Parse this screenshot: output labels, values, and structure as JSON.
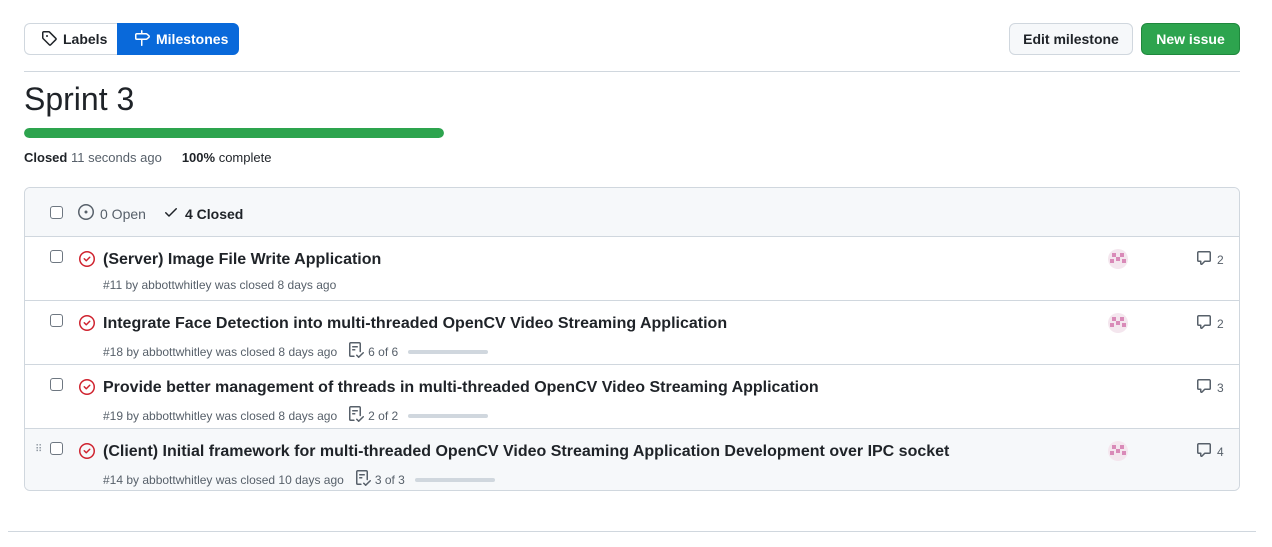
{
  "nav": {
    "labels_label": "Labels",
    "milestones_label": "Milestones"
  },
  "actions": {
    "edit_label": "Edit milestone",
    "new_issue_label": "New issue"
  },
  "milestone": {
    "title": "Sprint 3",
    "progress_percent": 100,
    "status_label": "Closed",
    "status_time": "11 seconds ago",
    "percent_text": "100%",
    "complete_text": "complete"
  },
  "filters": {
    "open_label": "0 Open",
    "closed_label": "4 Closed"
  },
  "issues": [
    {
      "title": "(Server) Image File Write Application",
      "meta": "#11 by abbottwhitley was closed 8 days ago",
      "tasks": "",
      "comments": "2",
      "has_avatar": true
    },
    {
      "title": "Integrate Face Detection into multi-threaded OpenCV Video Streaming Application",
      "meta": "#18 by abbottwhitley was closed 8 days ago",
      "tasks": "6 of 6",
      "comments": "2",
      "has_avatar": true
    },
    {
      "title": "Provide better management of threads in multi-threaded OpenCV Video Streaming Application",
      "meta": "#19 by abbottwhitley was closed 8 days ago",
      "tasks": "2 of 2",
      "comments": "3",
      "has_avatar": false
    },
    {
      "title": "(Client) Initial framework for multi-threaded OpenCV Video Streaming Application Development over IPC socket",
      "meta": "#14 by abbottwhitley was closed 10 days ago",
      "tasks": "3 of 3",
      "comments": "4",
      "has_avatar": true
    }
  ],
  "colors": {
    "accent_blue": "#0969da",
    "success_green": "#2da44e",
    "closed_icon_red": "#cf222e"
  }
}
